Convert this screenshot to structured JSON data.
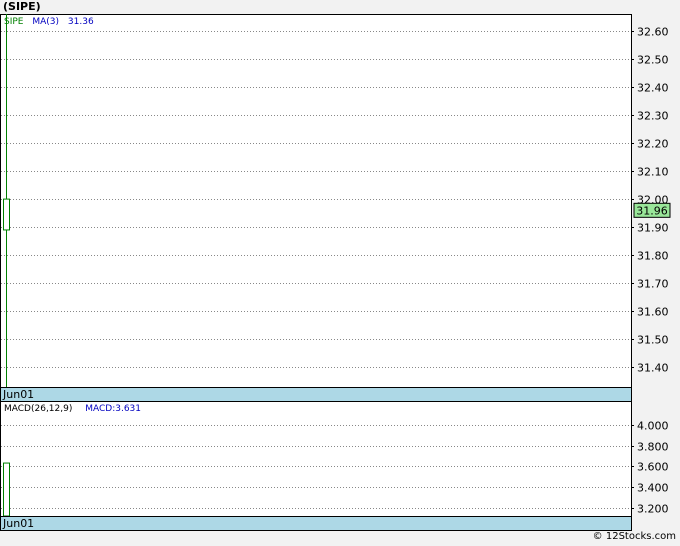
{
  "header": {
    "title": "(SIPE)"
  },
  "footer": {
    "credit": "© 12Stocks.com"
  },
  "chart_data": [
    {
      "type": "candlestick",
      "panel": "price",
      "legend": {
        "symbol": "SIPE",
        "ma_label": "MA(3)",
        "ma_value": "31.36"
      },
      "date_label": "Jun01",
      "ylim": [
        31.33,
        32.66
      ],
      "yticks": [
        32.6,
        32.5,
        32.4,
        32.3,
        32.2,
        32.1,
        32.0,
        31.9,
        31.8,
        31.7,
        31.6,
        31.5,
        31.4
      ],
      "ytick_labels": [
        "32.60",
        "32.50",
        "32.40",
        "32.30",
        "32.20",
        "32.10",
        "32.00",
        "31.90",
        "31.80",
        "31.70",
        "31.60",
        "31.50",
        "31.40"
      ],
      "last_price": "31.96",
      "candles": [
        {
          "date": "Jun01",
          "open": 31.89,
          "close": 32.0,
          "high": 32.66,
          "low": 31.33
        }
      ],
      "grid": true,
      "colors": {
        "up": "#008000",
        "label_bg": "#99e699",
        "date_bar": "#add8e6",
        "legend_ma": "#0000c0"
      }
    },
    {
      "type": "bar",
      "panel": "macd",
      "legend": {
        "params": "MACD(26,12,9)",
        "value_label": "MACD:3.631"
      },
      "date_label": "Jun01",
      "ylim": [
        3.12,
        4.23
      ],
      "yticks": [
        4.0,
        3.8,
        3.6,
        3.4,
        3.2
      ],
      "ytick_labels": [
        "4.000",
        "3.800",
        "3.600",
        "3.400",
        "3.200"
      ],
      "bars": [
        {
          "date": "Jun01",
          "value": 3.631
        }
      ],
      "grid": true
    }
  ]
}
